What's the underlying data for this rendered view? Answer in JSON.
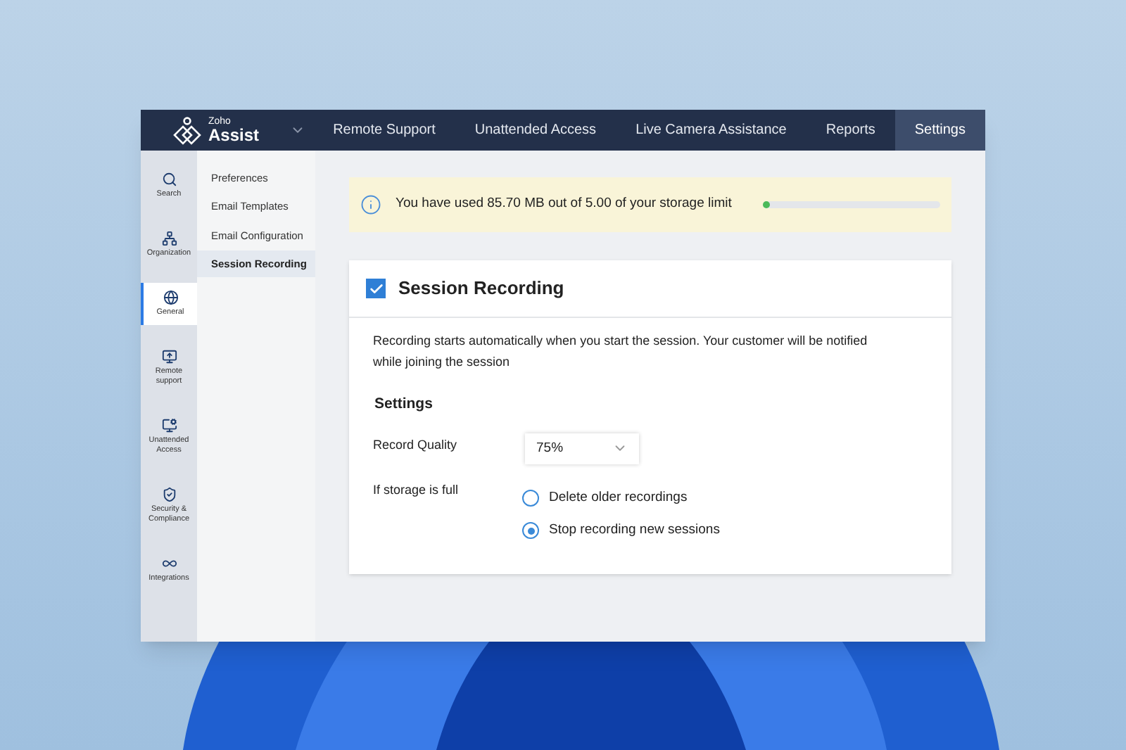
{
  "logo": {
    "small": "Zoho",
    "name": "Assist"
  },
  "top_nav": [
    {
      "label": "Remote Support",
      "selected": false
    },
    {
      "label": "Unattended Access",
      "selected": false
    },
    {
      "label": "Live Camera Assistance",
      "selected": false
    },
    {
      "label": "Reports",
      "selected": false
    },
    {
      "label": "Settings",
      "selected": true
    }
  ],
  "icon_rail": [
    {
      "kind": "search",
      "label": "Search",
      "selected": false
    },
    {
      "kind": "organization",
      "label": "Organization",
      "selected": false
    },
    {
      "kind": "globe",
      "label": "General",
      "selected": true
    },
    {
      "kind": "remote",
      "label": "Remote support",
      "selected": false
    },
    {
      "kind": "unattended",
      "label": "Unattended Access",
      "selected": false
    },
    {
      "kind": "shield",
      "label": "Security & Compliance",
      "selected": false
    },
    {
      "kind": "integrations",
      "label": "Integrations",
      "selected": false
    }
  ],
  "submenu": [
    {
      "label": "Preferences",
      "selected": false
    },
    {
      "label": "Email Templates",
      "selected": false
    },
    {
      "label": "Email Configuration",
      "selected": false
    },
    {
      "label": "Session Recording",
      "selected": true
    }
  ],
  "storage_banner": {
    "text": "You have used 85.70 MB out of 5.00 of your storage limit",
    "level": 0.02
  },
  "card": {
    "title": "Session Recording",
    "checked": true,
    "description": "Recording starts automatically when you start the session. Your customer will be notified while joining the session",
    "section": "Settings",
    "quality": {
      "label": "Record Quality",
      "value": "75%"
    },
    "storage_full": {
      "label": "If storage is full",
      "options": [
        {
          "label": "Delete older recordings",
          "selected": false
        },
        {
          "label": "Stop recording new sessions",
          "selected": true
        }
      ]
    }
  }
}
